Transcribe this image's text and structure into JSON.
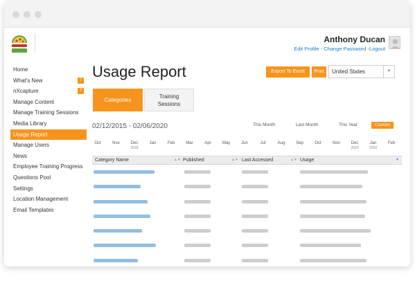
{
  "user": {
    "name": "Anthony Ducan",
    "edit_profile": "Edit Profile",
    "sep": " - ",
    "change_password": "Change Password",
    "sep2": " -",
    "logout": "Logout"
  },
  "sidebar": {
    "items": [
      {
        "label": "Home",
        "badge": ""
      },
      {
        "label": "What's New",
        "badge": "7"
      },
      {
        "label": "nXcapture",
        "badge": "7"
      },
      {
        "label": "Manage Content",
        "badge": ""
      },
      {
        "label": "Manage Training Sessions",
        "badge": ""
      },
      {
        "label": "Media Library",
        "badge": ""
      },
      {
        "label": "Usage Report",
        "badge": "",
        "active": true
      },
      {
        "label": "Manage Users",
        "badge": ""
      },
      {
        "label": "News",
        "badge": ""
      },
      {
        "label": "Employee Training Progress",
        "badge": ""
      },
      {
        "label": "Questions Pool",
        "badge": ""
      },
      {
        "label": "Settings",
        "badge": ""
      },
      {
        "label": "Location Management",
        "badge": ""
      },
      {
        "label": "Email Templates",
        "badge": ""
      }
    ]
  },
  "main": {
    "title": "Usage Report",
    "export_label": "Export To Excel",
    "print_label": "Print",
    "country": "United States",
    "tabs": [
      {
        "label": "Categories",
        "active": true
      },
      {
        "label": "Training Sessions",
        "active": false
      }
    ],
    "date_range": "02/12/2015 - 02/06/2020",
    "filters": [
      {
        "label": "This Month"
      },
      {
        "label": "Last Month"
      },
      {
        "label": "This Year"
      },
      {
        "label": "Custom",
        "active": true
      }
    ]
  },
  "timeline": [
    {
      "m": "Oct",
      "y": ""
    },
    {
      "m": "Nov",
      "y": ""
    },
    {
      "m": "Dec",
      "y": "2018"
    },
    {
      "m": "Jan",
      "y": ""
    },
    {
      "m": "Feb",
      "y": ""
    },
    {
      "m": "Mar",
      "y": ""
    },
    {
      "m": "Apr",
      "y": ""
    },
    {
      "m": "May",
      "y": ""
    },
    {
      "m": "Jun",
      "y": ""
    },
    {
      "m": "Jul",
      "y": ""
    },
    {
      "m": "Aug",
      "y": ""
    },
    {
      "m": "Sep",
      "y": ""
    },
    {
      "m": "Oct",
      "y": ""
    },
    {
      "m": "Nov",
      "y": ""
    },
    {
      "m": "Dec",
      "y": "2019"
    },
    {
      "m": "Jan",
      "y": "2020"
    },
    {
      "m": "Feb",
      "y": ""
    }
  ],
  "table": {
    "columns": [
      "Category Name",
      "Published",
      "Last Accessed",
      "Usage"
    ],
    "row_count": 7
  },
  "icons": {
    "avatar": "user-avatar-icon",
    "select_arrow": "chevron-down-icon",
    "sort": "sort-icon"
  },
  "colors": {
    "accent": "#f7941d",
    "link": "#1a7fc4"
  }
}
